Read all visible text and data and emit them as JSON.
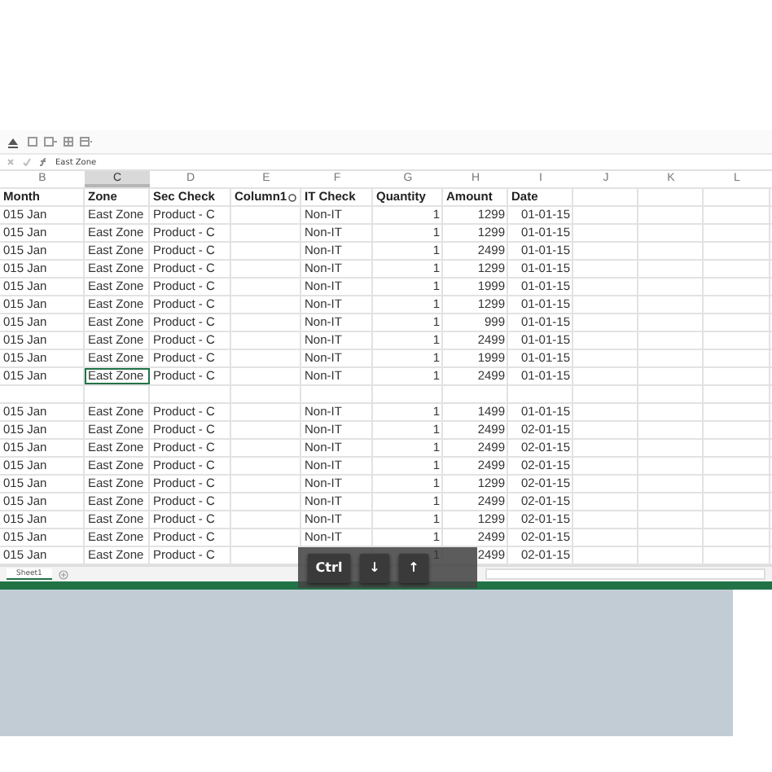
{
  "formula_bar": {
    "value": "East Zone"
  },
  "columns": [
    {
      "letter": "B",
      "selected": false
    },
    {
      "letter": "C",
      "selected": true
    },
    {
      "letter": "D",
      "selected": false
    },
    {
      "letter": "E",
      "selected": false
    },
    {
      "letter": "F",
      "selected": false
    },
    {
      "letter": "G",
      "selected": false
    },
    {
      "letter": "H",
      "selected": false
    },
    {
      "letter": "I",
      "selected": false
    },
    {
      "letter": "J",
      "selected": false
    },
    {
      "letter": "K",
      "selected": false
    },
    {
      "letter": "L",
      "selected": false
    }
  ],
  "rows": [
    {
      "kind": "header",
      "month": "Month",
      "zone": "Zone",
      "sec_check": "Sec Check",
      "column1": "Column1",
      "it_check": "IT Check",
      "quantity": "Quantity",
      "amount": "Amount",
      "date": "Date"
    },
    {
      "kind": "data",
      "selected": false,
      "month": "015 Jan",
      "zone": "East Zone",
      "sec_check": "Product - C",
      "it_check": "Non-IT",
      "quantity": "1",
      "amount": "1299",
      "date": "01-01-15"
    },
    {
      "kind": "data",
      "selected": false,
      "month": "015 Jan",
      "zone": "East Zone",
      "sec_check": "Product - C",
      "it_check": "Non-IT",
      "quantity": "1",
      "amount": "1299",
      "date": "01-01-15"
    },
    {
      "kind": "data",
      "selected": false,
      "month": "015 Jan",
      "zone": "East Zone",
      "sec_check": "Product - C",
      "it_check": "Non-IT",
      "quantity": "1",
      "amount": "2499",
      "date": "01-01-15"
    },
    {
      "kind": "data",
      "selected": false,
      "month": "015 Jan",
      "zone": "East Zone",
      "sec_check": "Product - C",
      "it_check": "Non-IT",
      "quantity": "1",
      "amount": "1299",
      "date": "01-01-15"
    },
    {
      "kind": "data",
      "selected": false,
      "month": "015 Jan",
      "zone": "East Zone",
      "sec_check": "Product - C",
      "it_check": "Non-IT",
      "quantity": "1",
      "amount": "1999",
      "date": "01-01-15"
    },
    {
      "kind": "data",
      "selected": false,
      "month": "015 Jan",
      "zone": "East Zone",
      "sec_check": "Product - C",
      "it_check": "Non-IT",
      "quantity": "1",
      "amount": "1299",
      "date": "01-01-15"
    },
    {
      "kind": "data",
      "selected": false,
      "month": "015 Jan",
      "zone": "East Zone",
      "sec_check": "Product - C",
      "it_check": "Non-IT",
      "quantity": "1",
      "amount": "999",
      "date": "01-01-15"
    },
    {
      "kind": "data",
      "selected": false,
      "month": "015 Jan",
      "zone": "East Zone",
      "sec_check": "Product - C",
      "it_check": "Non-IT",
      "quantity": "1",
      "amount": "2499",
      "date": "01-01-15"
    },
    {
      "kind": "data",
      "selected": false,
      "month": "015 Jan",
      "zone": "East Zone",
      "sec_check": "Product - C",
      "it_check": "Non-IT",
      "quantity": "1",
      "amount": "1999",
      "date": "01-01-15"
    },
    {
      "kind": "data",
      "selected": true,
      "month": "015 Jan",
      "zone": "East Zone",
      "sec_check": "Product - C",
      "it_check": "Non-IT",
      "quantity": "1",
      "amount": "2499",
      "date": "01-01-15"
    },
    {
      "kind": "blank"
    },
    {
      "kind": "data",
      "selected": false,
      "month": "015 Jan",
      "zone": "East Zone",
      "sec_check": "Product - C",
      "it_check": "Non-IT",
      "quantity": "1",
      "amount": "1499",
      "date": "01-01-15"
    },
    {
      "kind": "data",
      "selected": false,
      "month": "015 Jan",
      "zone": "East Zone",
      "sec_check": "Product - C",
      "it_check": "Non-IT",
      "quantity": "1",
      "amount": "2499",
      "date": "02-01-15"
    },
    {
      "kind": "data",
      "selected": false,
      "month": "015 Jan",
      "zone": "East Zone",
      "sec_check": "Product - C",
      "it_check": "Non-IT",
      "quantity": "1",
      "amount": "2499",
      "date": "02-01-15"
    },
    {
      "kind": "data",
      "selected": false,
      "month": "015 Jan",
      "zone": "East Zone",
      "sec_check": "Product - C",
      "it_check": "Non-IT",
      "quantity": "1",
      "amount": "2499",
      "date": "02-01-15"
    },
    {
      "kind": "data",
      "selected": false,
      "month": "015 Jan",
      "zone": "East Zone",
      "sec_check": "Product - C",
      "it_check": "Non-IT",
      "quantity": "1",
      "amount": "1299",
      "date": "02-01-15"
    },
    {
      "kind": "data",
      "selected": false,
      "month": "015 Jan",
      "zone": "East Zone",
      "sec_check": "Product - C",
      "it_check": "Non-IT",
      "quantity": "1",
      "amount": "2499",
      "date": "02-01-15"
    },
    {
      "kind": "data",
      "selected": false,
      "month": "015 Jan",
      "zone": "East Zone",
      "sec_check": "Product - C",
      "it_check": "Non-IT",
      "quantity": "1",
      "amount": "1299",
      "date": "02-01-15"
    },
    {
      "kind": "data",
      "selected": false,
      "month": "015 Jan",
      "zone": "East Zone",
      "sec_check": "Product - C",
      "it_check": "Non-IT",
      "quantity": "1",
      "amount": "2499",
      "date": "02-01-15"
    },
    {
      "kind": "data",
      "selected": false,
      "month": "015 Jan",
      "zone": "East Zone",
      "sec_check": "Product - C",
      "quantity": "1",
      "amount": "2499",
      "date": "02-01-15"
    }
  ],
  "sheet_tabs": [
    {
      "label": "Sheet1",
      "selected": true
    }
  ],
  "keys": [
    "Ctrl",
    "↓",
    "↑"
  ]
}
